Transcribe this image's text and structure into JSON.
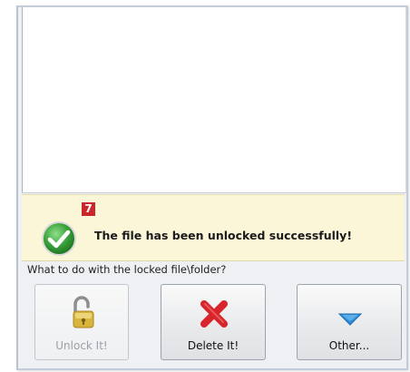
{
  "status": {
    "badge": "7",
    "message": "The file has been unlocked successfully!",
    "icon": "check-circle-icon",
    "color_success": "#3aa23a"
  },
  "actions": {
    "prompt": "What to do with the locked file\\folder?",
    "buttons": [
      {
        "label": "Unlock It!",
        "icon": "padlock-open-icon",
        "enabled": false
      },
      {
        "label": "Delete It!",
        "icon": "red-x-icon",
        "enabled": true
      },
      {
        "label": "Other...",
        "icon": "chevron-down-icon",
        "enabled": true
      }
    ]
  },
  "colors": {
    "status_background": "#fbf6d8",
    "badge": "#c8262b",
    "delete_red": "#d8252b",
    "other_blue": "#2f8fd8"
  }
}
